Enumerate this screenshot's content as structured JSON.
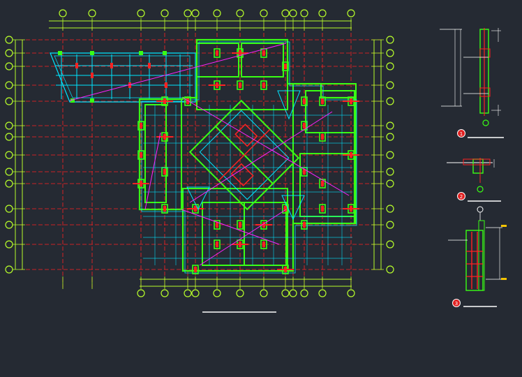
{
  "colors": {
    "background": "#252a33",
    "axis_line": "#ff2222",
    "wall": "#39ff14",
    "column": "#ff2222",
    "beam": "#00e5ff",
    "brace": "#ff22ff",
    "dim_line": "#b8ff2a",
    "bubble": "#b8ff2a",
    "detail_text": "#ffffff",
    "detail_title_marker": "#e02020"
  },
  "plan": {
    "top_axis_labels": [
      "",
      "",
      "",
      "",
      "",
      "",
      "",
      "",
      "",
      "",
      "",
      "",
      "",
      ""
    ],
    "side_axis_labels": [
      "",
      "",
      "",
      "",
      "",
      "",
      "",
      "",
      "",
      "",
      "",
      "",
      "",
      ""
    ],
    "title": "",
    "subtitle": ""
  },
  "details": [
    {
      "number": "1",
      "title": ""
    },
    {
      "number": "2",
      "title": ""
    },
    {
      "number": "3",
      "title": ""
    }
  ]
}
